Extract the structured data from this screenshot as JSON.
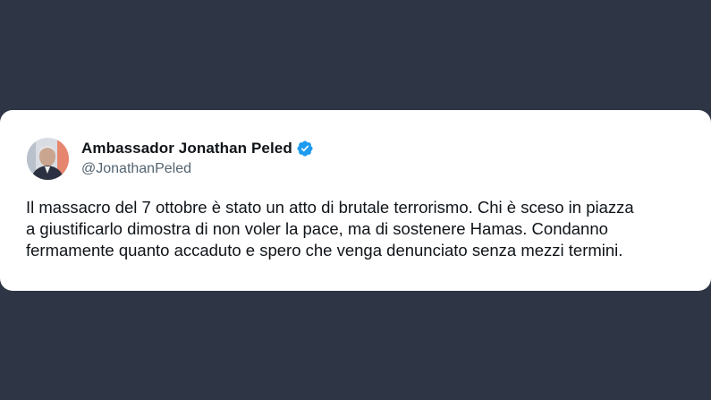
{
  "tweet": {
    "author": {
      "display_name": "Ambassador Jonathan Peled",
      "handle": "@JonathanPeled",
      "verified": true,
      "avatar_icon": "profile-photo",
      "verified_icon": "verified-badge-icon"
    },
    "text": "Il massacro del 7 ottobre è stato un atto di brutale terrorismo. Chi è sceso in piazza\na giustificarlo dimostra di non voler la pace, ma di sostenere Hamas. Condanno\nfermamente quanto accaduto e spero che venga denunciato senza mezzi termini."
  },
  "colors": {
    "background": "#2e3545",
    "card": "#ffffff",
    "text_primary": "#0f1419",
    "text_secondary": "#536471",
    "verified_blue": "#1d9bf0"
  }
}
